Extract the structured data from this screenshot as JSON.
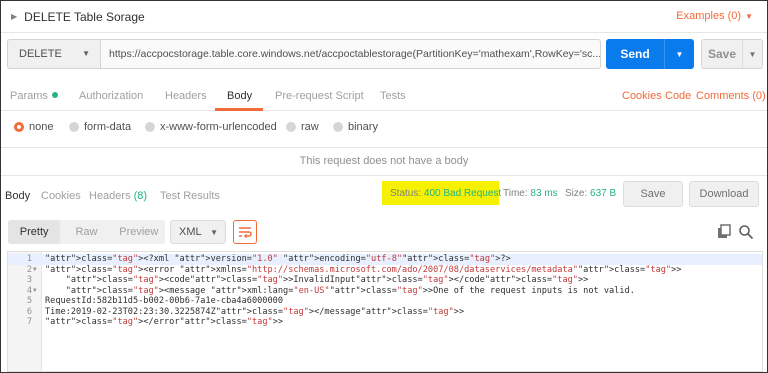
{
  "titlebar": {
    "title": "DELETE Table Sorage",
    "examples_label": "Examples (0)"
  },
  "request": {
    "method": "DELETE",
    "url": "https://accpocstorage.table.core.windows.net/accpoctablestorage(PartitionKey='mathexam',RowKey='sc...",
    "send_label": "Send",
    "save_label": "Save"
  },
  "request_tabs": {
    "params": "Params",
    "authorization": "Authorization",
    "headers": "Headers",
    "body": "Body",
    "prerequest": "Pre-request Script",
    "tests": "Tests",
    "cookies": "Cookies",
    "code": "Code",
    "comments": "Comments (0)"
  },
  "body_types": {
    "none": "none",
    "form_data": "form-data",
    "urlencoded": "x-www-form-urlencoded",
    "raw": "raw",
    "binary": "binary",
    "selected": "none"
  },
  "no_body_message": "This request does not have a body",
  "response_tabs": {
    "body": "Body",
    "cookies": "Cookies",
    "headers": "Headers",
    "headers_count": "(8)",
    "test_results": "Test Results"
  },
  "response_meta": {
    "status_label": "Status:",
    "status_value": "400 Bad Request",
    "time_label": "Time:",
    "time_value": "83 ms",
    "size_label": "Size:",
    "size_value": "637 B",
    "save_label": "Save",
    "download_label": "Download"
  },
  "response_toolbar": {
    "pretty": "Pretty",
    "raw": "Raw",
    "preview": "Preview",
    "format": "XML"
  },
  "code_lines": [
    {
      "n": "1",
      "text": "<?xml version=\"1.0\" encoding=\"utf-8\"?>"
    },
    {
      "n": "2",
      "text": "<error xmlns=\"http://schemas.microsoft.com/ado/2007/08/dataservices/metadata\">"
    },
    {
      "n": "3",
      "text": "    <code>InvalidInput</code>"
    },
    {
      "n": "4",
      "text": "    <message xml:lang=\"en-US\">One of the request inputs is not valid."
    },
    {
      "n": "5",
      "text": "RequestId:582b11d5-b002-00b6-7a1e-cba4a6000000"
    },
    {
      "n": "6",
      "text": "Time:2019-02-23T02:23:30.3225874Z</message>"
    },
    {
      "n": "7",
      "text": "</error>"
    }
  ],
  "colors": {
    "accent": "#f26b3a",
    "send_blue": "#097bed",
    "success_green": "#26b47f",
    "status_highlight": "#f5f100"
  },
  "icons": {
    "title_caret": "caret-right-icon",
    "copy": "copy-icon",
    "search": "search-icon",
    "wrap": "wrap-lines-icon"
  }
}
